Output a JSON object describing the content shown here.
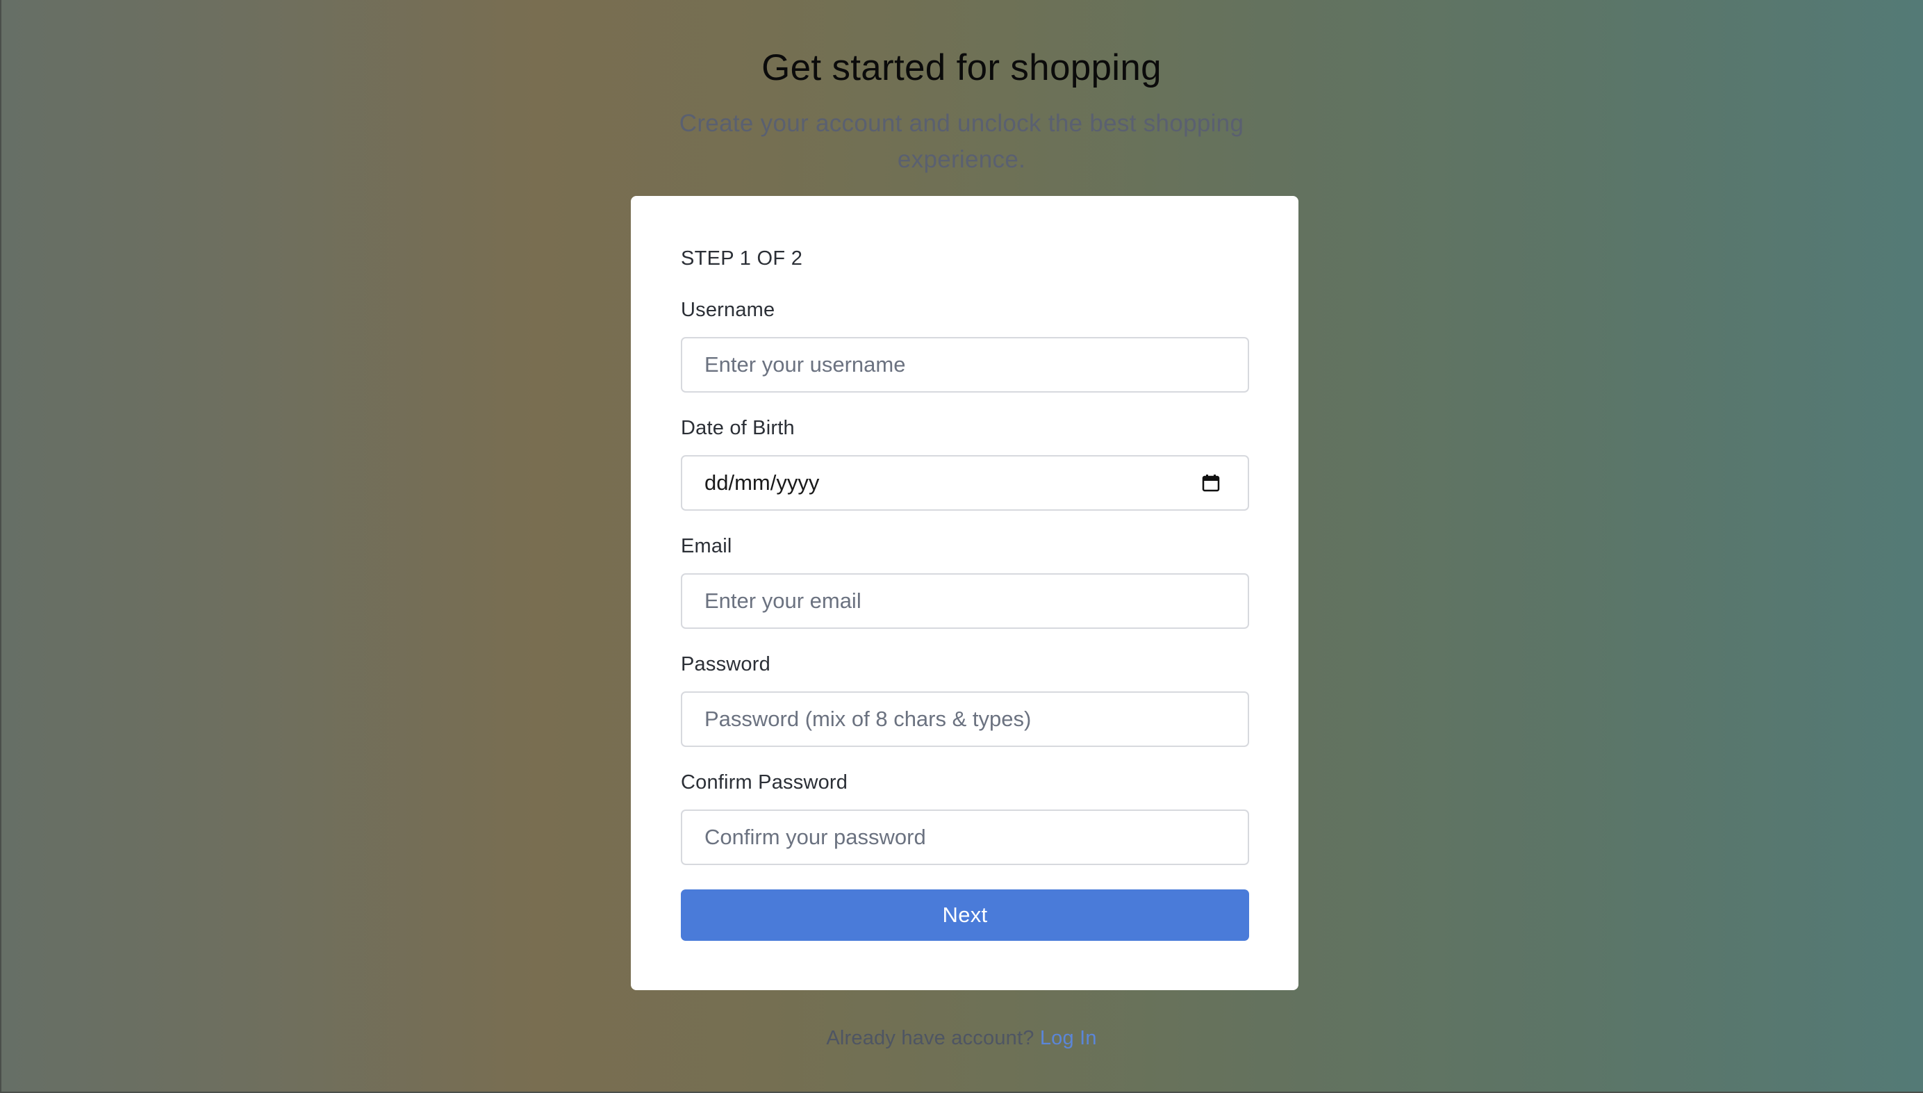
{
  "header": {
    "title": "Get started for shopping",
    "subtitle": "Create your account and unclock the best shopping experience."
  },
  "form": {
    "step": "STEP 1 OF 2",
    "fields": [
      {
        "label": "Username",
        "placeholder": "Enter your username"
      },
      {
        "label": "Date of Birth",
        "placeholder": "dd/mm/yyyy"
      },
      {
        "label": "Email",
        "placeholder": "Enter your email"
      },
      {
        "label": "Password",
        "placeholder": "Password (mix of 8 chars & types)"
      },
      {
        "label": "Confirm Password",
        "placeholder": "Confirm your password"
      }
    ],
    "next_label": "Next"
  },
  "footer": {
    "prompt": "Already have account?",
    "login_label": "Log In"
  },
  "colors": {
    "accent": "#4a7bd9",
    "link": "#5b86d8",
    "card": "#ffffff"
  },
  "icons": {
    "date_picker": "calendar-icon"
  }
}
